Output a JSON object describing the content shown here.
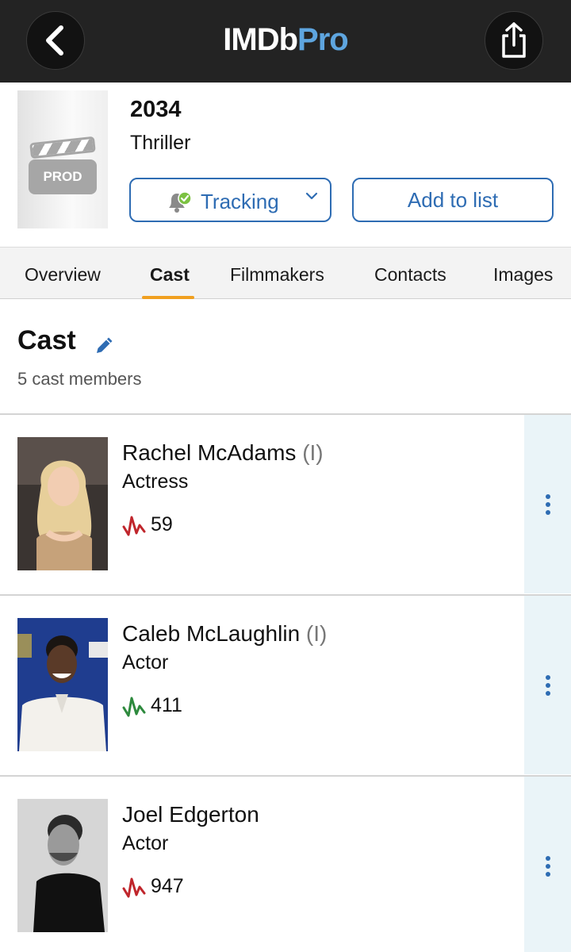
{
  "header": {
    "logo_main": "IMDb",
    "logo_accent": "Pro",
    "back_icon": "chevron-left-icon",
    "share_icon": "share-icon"
  },
  "title": {
    "poster_badge": "PROD",
    "year": "2034",
    "genre": "Thriller",
    "tracking_label": "Tracking",
    "add_to_list_label": "Add to list"
  },
  "tabs": [
    {
      "label": "Overview",
      "active": false
    },
    {
      "label": "Cast",
      "active": true
    },
    {
      "label": "Filmmakers",
      "active": false
    },
    {
      "label": "Contacts",
      "active": false
    },
    {
      "label": "Images",
      "active": false
    }
  ],
  "cast": {
    "heading": "Cast",
    "count_label": "5 cast members",
    "members": [
      {
        "name": "Rachel McAdams",
        "suffix": "(I)",
        "role": "Actress",
        "starmeter": "59",
        "trend": "down",
        "trend_color": "#c0262c"
      },
      {
        "name": "Caleb McLaughlin",
        "suffix": "(I)",
        "role": "Actor",
        "starmeter": "411",
        "trend": "up",
        "trend_color": "#2e8a3e"
      },
      {
        "name": "Joel Edgerton",
        "suffix": "",
        "role": "Actor",
        "starmeter": "947",
        "trend": "down",
        "trend_color": "#c0262c"
      }
    ]
  },
  "colors": {
    "topbar": "#232323",
    "accent_blue": "#2e6cb3",
    "logo_pro": "#5ea5df",
    "tab_underline": "#f0a020"
  }
}
